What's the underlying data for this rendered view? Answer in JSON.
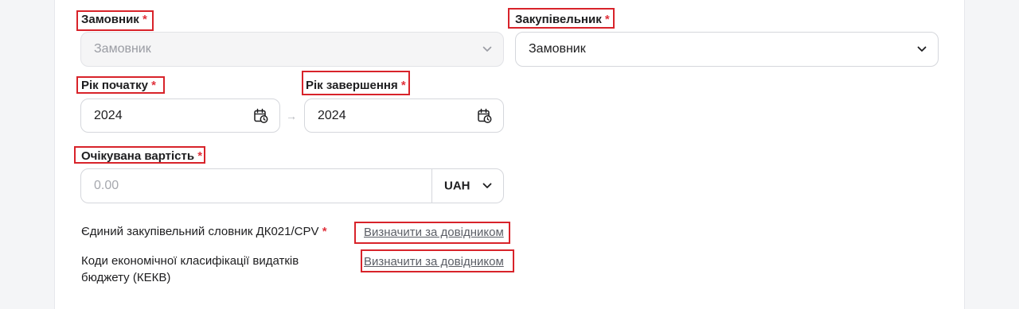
{
  "customer": {
    "label": "Замовник",
    "required": "*",
    "value": "Замовник"
  },
  "purchaser": {
    "label": "Закупівельник",
    "required": "*",
    "value": "Замовник"
  },
  "start_year": {
    "label": "Рік початку",
    "required": "*",
    "value": "2024"
  },
  "end_year": {
    "label": "Рік завершення",
    "required": "*",
    "value": "2024"
  },
  "range_separator": "→",
  "expected_cost": {
    "label": "Очікувана вартість",
    "required": "*",
    "placeholder": "0.00",
    "currency": "UAH"
  },
  "cpv": {
    "label": "Єдиний закупівельний словник ДК021/CPV",
    "required": "*",
    "link": "Визначити за довідником"
  },
  "kekv": {
    "label_line1": "Коди економічної класифікації видатків",
    "label_line2": "бюджету (КЕКВ)",
    "link": "Визначити за довідником"
  },
  "colors": {
    "highlight": "#d8232a",
    "required": "#e0323c",
    "link": "#5b5e66"
  },
  "icons": {
    "select": "chevron-down-icon",
    "date": "calendar-clock-icon"
  }
}
